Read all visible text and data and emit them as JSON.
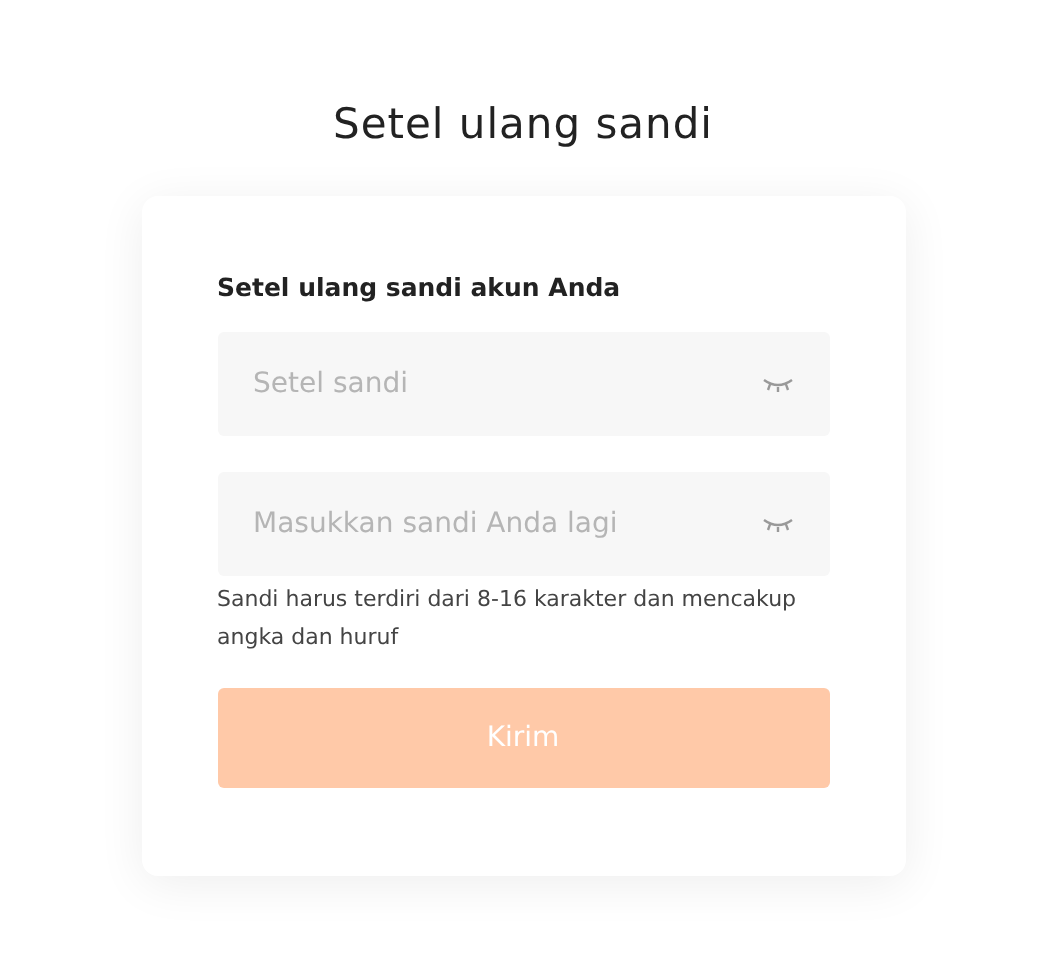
{
  "title": "Setel ulang sandi",
  "form": {
    "heading": "Setel ulang sandi akun Anda",
    "fields": [
      {
        "placeholder": "Setel sandi"
      },
      {
        "placeholder": "Masukkan sandi Anda lagi"
      }
    ],
    "hint": "Sandi harus terdiri dari 8-16 karakter dan mencakup angka dan huruf",
    "submit": {
      "label": "Kirim",
      "disabled": true
    }
  }
}
